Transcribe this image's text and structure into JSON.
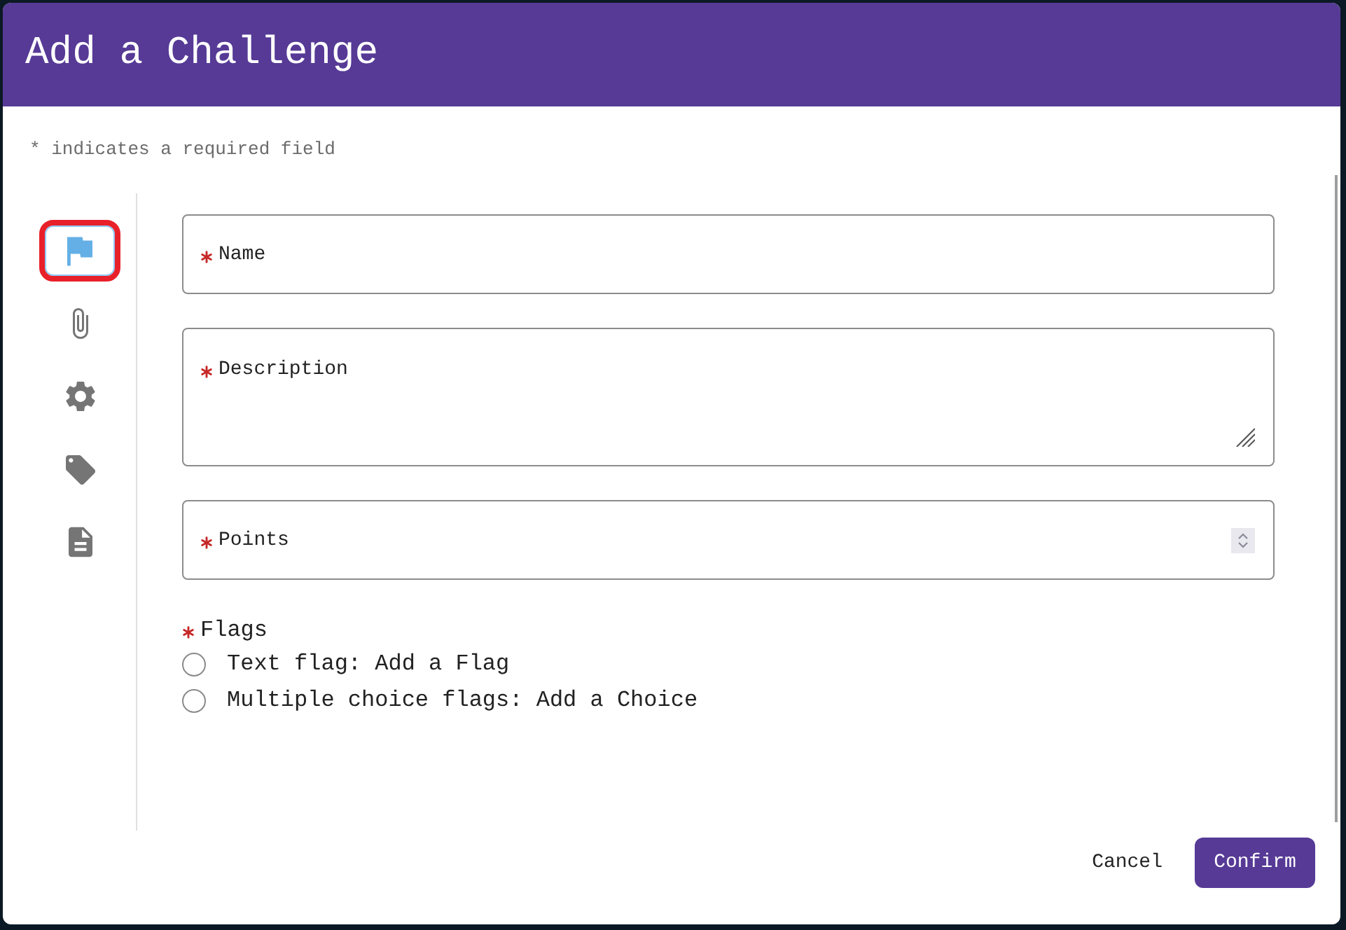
{
  "dialog": {
    "title": "Add a Challenge",
    "required_note": "* indicates a required field"
  },
  "sidebar": {
    "tabs": [
      {
        "kind": "flag",
        "selected": true
      },
      {
        "kind": "attachment",
        "selected": false
      },
      {
        "kind": "settings",
        "selected": false
      },
      {
        "kind": "tag",
        "selected": false
      },
      {
        "kind": "document",
        "selected": false
      }
    ]
  },
  "form": {
    "fields": [
      {
        "kind": "text",
        "label": "Name",
        "required": true
      },
      {
        "kind": "textarea",
        "label": "Description",
        "required": true
      },
      {
        "kind": "number",
        "label": "Points",
        "required": true
      }
    ],
    "flags": {
      "label": "Flags",
      "required": true,
      "options": [
        {
          "label": "Text flag: Add a Flag",
          "selected": false
        },
        {
          "label": "Multiple choice flags: Add a Choice",
          "selected": false
        }
      ]
    }
  },
  "buttons": [
    {
      "kind": "text",
      "label": "Cancel"
    },
    {
      "kind": "primary",
      "label": "Confirm"
    }
  ]
}
